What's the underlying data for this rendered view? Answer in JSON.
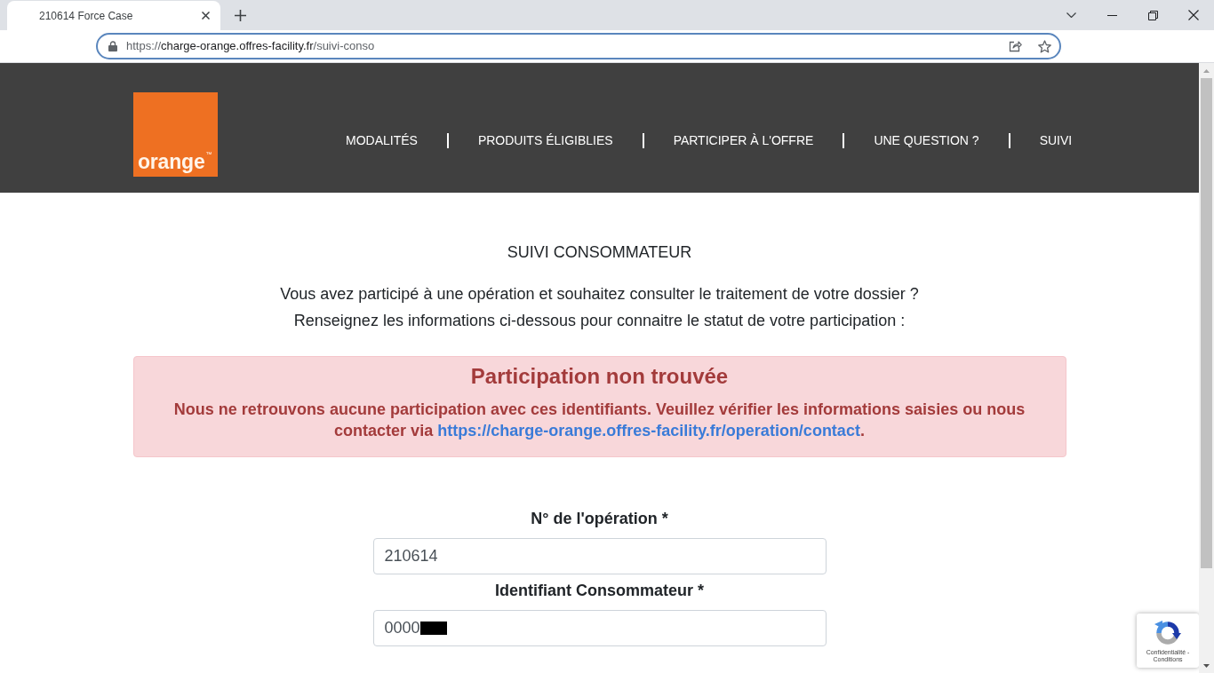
{
  "browser": {
    "tab": {
      "title": "210614 Force Case"
    },
    "address_bar": {
      "scheme": "https://",
      "host": "charge-orange.offres-facility.fr",
      "path": "/suivi-conso"
    }
  },
  "header": {
    "logo": {
      "text": "orange",
      "mark": "™"
    },
    "nav": [
      {
        "label": "MODALITÉS"
      },
      {
        "label": "PRODUITS ÉLIGIBLIES"
      },
      {
        "label": "PARTICIPER À L'OFFRE"
      },
      {
        "label": "UNE QUESTION ?"
      },
      {
        "label": "SUIVI"
      }
    ]
  },
  "page": {
    "heading": "SUIVI CONSOMMATEUR",
    "intro": [
      "Vous avez participé à une opération et souhaitez consulter le traitement de votre dossier ?",
      "Renseignez les informations ci-dessous pour connaitre le statut de votre participation :"
    ],
    "alert": {
      "title": "Participation non trouvée",
      "message": "Nous ne retrouvons aucune participation avec ces identifiants. Veuillez vérifier les informations saisies ou nous contacter via ",
      "link": "https://charge-orange.offres-facility.fr/operation/contact",
      "message_end": "."
    },
    "form": {
      "fields": [
        {
          "label": "N° de l'opération *",
          "value": "210614",
          "redacted": false
        },
        {
          "label": "Identifiant Consommateur *",
          "value": "0000",
          "redacted": true
        }
      ]
    }
  },
  "recaptcha": {
    "text": "Confidentialité - Conditions"
  }
}
